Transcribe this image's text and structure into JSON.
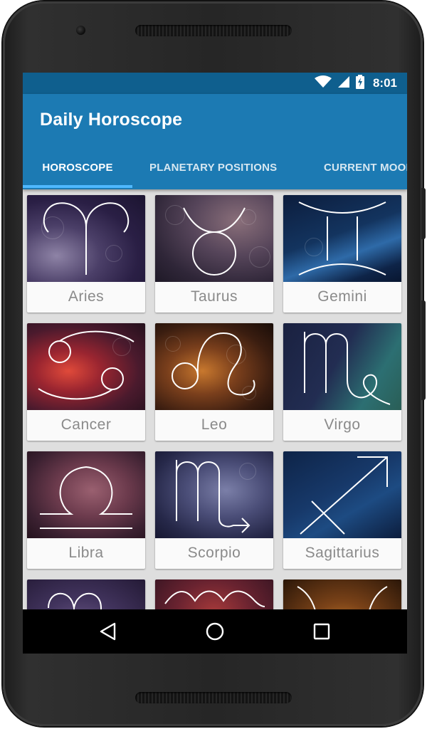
{
  "status_bar": {
    "time": "8:01",
    "icons": [
      "wifi-icon",
      "cell-signal-icon",
      "battery-charging-icon"
    ]
  },
  "app_bar": {
    "title": "Daily Horoscope"
  },
  "tabs": [
    {
      "label": "HOROSCOPE",
      "selected": true
    },
    {
      "label": "PLANETARY POSITIONS",
      "selected": false
    },
    {
      "label": "CURRENT MOON",
      "selected": false
    }
  ],
  "signs": [
    {
      "label": "Aries",
      "icon": "aries-symbol-icon"
    },
    {
      "label": "Taurus",
      "icon": "taurus-symbol-icon"
    },
    {
      "label": "Gemini",
      "icon": "gemini-symbol-icon"
    },
    {
      "label": "Cancer",
      "icon": "cancer-symbol-icon"
    },
    {
      "label": "Leo",
      "icon": "leo-symbol-icon"
    },
    {
      "label": "Virgo",
      "icon": "virgo-symbol-icon"
    },
    {
      "label": "Libra",
      "icon": "libra-symbol-icon"
    },
    {
      "label": "Scorpio",
      "icon": "scorpio-symbol-icon"
    },
    {
      "label": "Sagittarius",
      "icon": "sagittarius-symbol-icon"
    },
    {
      "label": "",
      "icon": "capricorn-symbol-icon"
    },
    {
      "label": "",
      "icon": "aquarius-symbol-icon"
    },
    {
      "label": "",
      "icon": "pisces-symbol-icon"
    }
  ],
  "nav_bar": {
    "icons": [
      "back-triangle-icon",
      "home-circle-icon",
      "recents-square-icon"
    ]
  },
  "colors": {
    "status_bar": "#0f5f8e",
    "app_bar": "#1c7ab3",
    "tab_indicator": "#4fb8ff",
    "grid_background": "#dedede",
    "card_label_text": "#8a8a8a"
  }
}
